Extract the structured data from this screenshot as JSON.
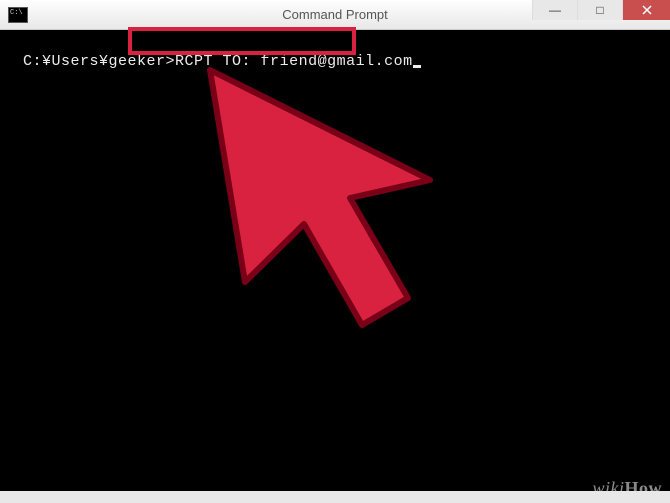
{
  "window": {
    "title": "Command Prompt",
    "minimize_symbol": "—",
    "maximize_symbol": "□"
  },
  "terminal": {
    "prompt": "C:¥Users¥geeker>",
    "command": "RCPT TO: friend@gmail.com"
  },
  "annotation": {
    "highlight_color": "#d8223f",
    "arrow_fill": "#d8223f",
    "arrow_stroke": "#7a0018"
  },
  "watermark": {
    "text_prefix": "wiki",
    "text_suffix": "How"
  }
}
